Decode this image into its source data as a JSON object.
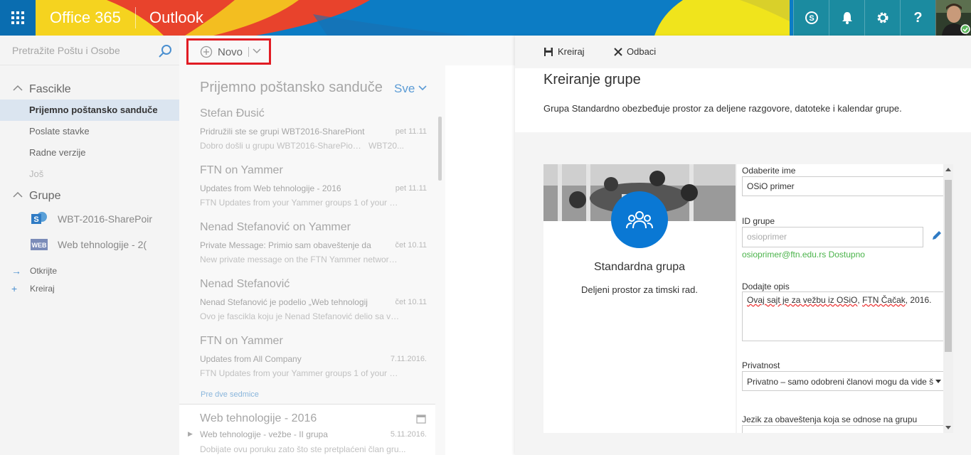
{
  "topbar": {
    "brand": "Office 365",
    "app": "Outlook",
    "icons": [
      "skype-icon",
      "bell-icon",
      "gear-icon",
      "help-icon"
    ],
    "help_label": "?",
    "colors": {
      "blue": "#0c7cc4",
      "yellow": "#f5d31f",
      "red": "#e8432c",
      "teal": "#1b8ba0"
    }
  },
  "search": {
    "placeholder": "Pretražite Poštu i Osobe"
  },
  "nav": {
    "folders_header": "Fascikle",
    "folders": [
      {
        "label": "Prijemno poštansko sanduče",
        "active": true
      },
      {
        "label": "Poslate stavke"
      },
      {
        "label": "Radne verzije"
      },
      {
        "label": "Još"
      }
    ],
    "groups_header": "Grupe",
    "groups": [
      {
        "label": "WBT-2016-SharePoir",
        "icon": "sharepoint-icon"
      },
      {
        "label": "Web tehnologije - 2(",
        "icon": "web-icon"
      }
    ],
    "actions": [
      {
        "icon": "→",
        "label": "Otkrijte"
      },
      {
        "icon": "+",
        "label": "Kreiraj"
      }
    ]
  },
  "newbtn": {
    "label": "Novo"
  },
  "mail_list": {
    "title": "Prijemno poštansko sanduče",
    "filter": "Sve",
    "items": [
      {
        "from": "Stefan Đusić",
        "subject": "Pridružili ste se grupi WBT2016-SharePiont",
        "date": "pet 11.11",
        "preview": "Dobro došli u grupu WBT2016-SharePiont.",
        "preview2": "WBT20..."
      },
      {
        "from": "FTN on Yammer",
        "subject": "Updates from Web tehnologije - 2016",
        "date": "pet 11.11",
        "preview": "FTN  Updates from your Yammer groups  1 of your gr...",
        "preview2": ""
      },
      {
        "from": "Nenad Stefanović on Yammer",
        "subject": "Private Message: Primio sam obaveštenje da",
        "date": "čet 10.11",
        "preview": "New private message on the FTN Yammer network F...",
        "preview2": ""
      },
      {
        "from": "Nenad Stefanović",
        "subject": "Nenad Stefanović je podelio „Web tehnologij",
        "date": "čet 10.11",
        "preview": "Ovo je fascikla koju je Nenad Stefanović delio sa vam...",
        "preview2": ""
      },
      {
        "from": "FTN on Yammer",
        "subject": "Updates from All Company",
        "date": "7.11.2016.",
        "preview": "FTN  Updates from your Yammer groups  1 of your gr...",
        "preview2": ""
      }
    ],
    "section_label": "Pre dve sedmice",
    "last": {
      "from": "Web tehnologije - 2016",
      "subject": "Web tehnologije - vežbe - II grupa",
      "date": "5.11.2016.",
      "preview": "Dobijate ovu poruku zato što ste pretplaćeni član gru..."
    }
  },
  "panel": {
    "save": "Kreiraj",
    "cancel": "Odbaci",
    "title": "Kreiranje grupe",
    "description": "Grupa Standardno obezbeđuje prostor za deljene razgovore, datoteke i kalendar grupe.",
    "card": {
      "name": "Standardna grupa",
      "sub": "Deljeni prostor za timski rad."
    },
    "form": {
      "name_label": "Odaberite ime",
      "name_value": "OSiO primer",
      "id_label": "ID grupe",
      "id_placeholder": "osioprimer",
      "email": "osioprimer@ftn.edu.rs",
      "available": "Dostupno",
      "desc_label": "Dodajte opis",
      "desc_parts": [
        "Ovaj sajt je za vežbu iz OSiO",
        ", ",
        "FTN Čačak",
        ", 2016."
      ],
      "privacy_label": "Privatnost",
      "privacy_value": "Privatno – samo odobreni članovi mogu da vide š",
      "lang_label": "Jezik za obaveštenja koja se odnose na grupu"
    }
  }
}
